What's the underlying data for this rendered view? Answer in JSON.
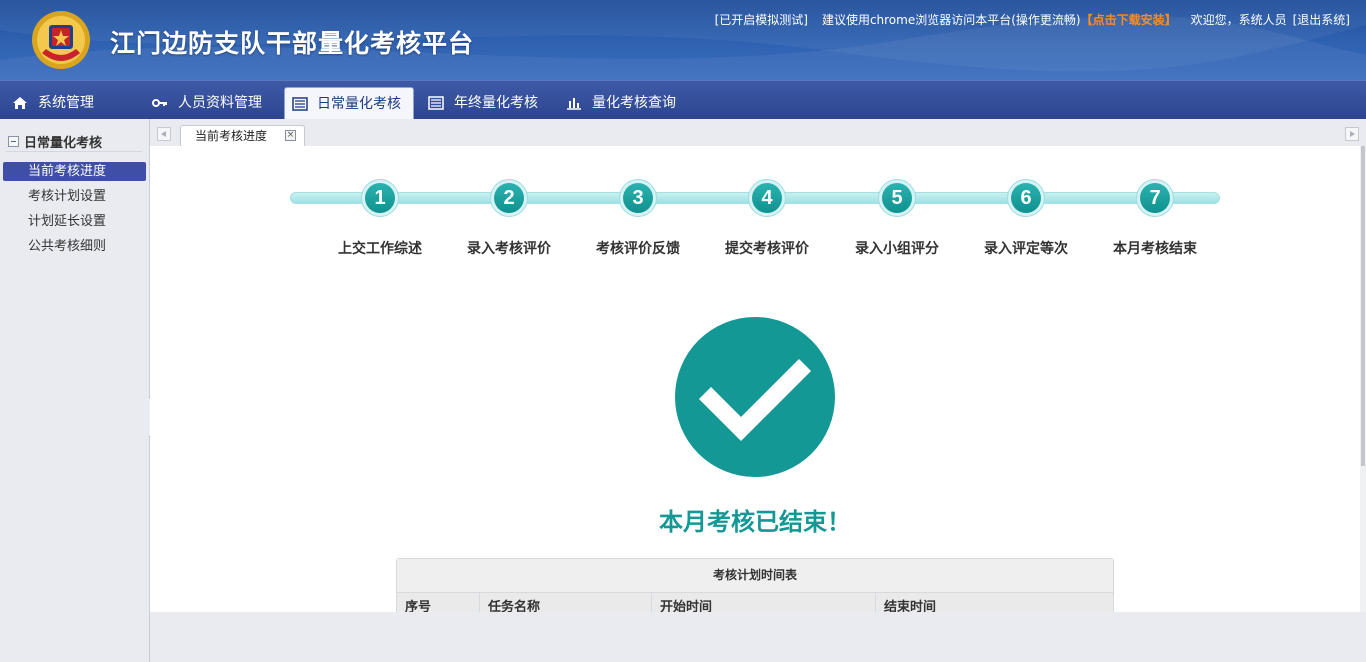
{
  "header": {
    "title": "江门边防支队干部量化考核平台",
    "links": {
      "simulation": "[已开启模拟测试]",
      "browser_tip": "建议使用chrome浏览器访问本平台(操作更流畅)",
      "download": "【点击下载安装】",
      "welcome": "欢迎您，系统人员",
      "logout": "[退出系统]"
    }
  },
  "nav": {
    "tabs": [
      {
        "label": "系统管理",
        "icon": "home-icon"
      },
      {
        "label": "人员资料管理",
        "icon": "key-icon"
      },
      {
        "label": "日常量化考核",
        "icon": "list-icon",
        "active": true
      },
      {
        "label": "年终量化考核",
        "icon": "list-icon"
      },
      {
        "label": "量化考核查询",
        "icon": "bar-chart-icon"
      }
    ]
  },
  "sidebar": {
    "title": "日常量化考核",
    "items": [
      {
        "label": "当前考核进度",
        "active": true
      },
      {
        "label": "考核计划设置"
      },
      {
        "label": "计划延长设置"
      },
      {
        "label": "公共考核细则"
      }
    ]
  },
  "page_tab": {
    "label": "当前考核进度",
    "close": "×"
  },
  "steps": [
    {
      "num": "1",
      "label": "上交工作综述"
    },
    {
      "num": "2",
      "label": "录入考核评价"
    },
    {
      "num": "3",
      "label": "考核评价反馈"
    },
    {
      "num": "4",
      "label": "提交考核评价"
    },
    {
      "num": "5",
      "label": "录入小组评分"
    },
    {
      "num": "6",
      "label": "录入评定等次"
    },
    {
      "num": "7",
      "label": "本月考核结束"
    }
  ],
  "status": {
    "message": "本月考核已结束！"
  },
  "schedule": {
    "title": "考核计划时间表",
    "columns": [
      "序号",
      "任务名称",
      "开始时间",
      "结束时间"
    ]
  },
  "colors": {
    "accent": "#139896",
    "brand": "#2d4590",
    "download": "#ff8a1e"
  }
}
